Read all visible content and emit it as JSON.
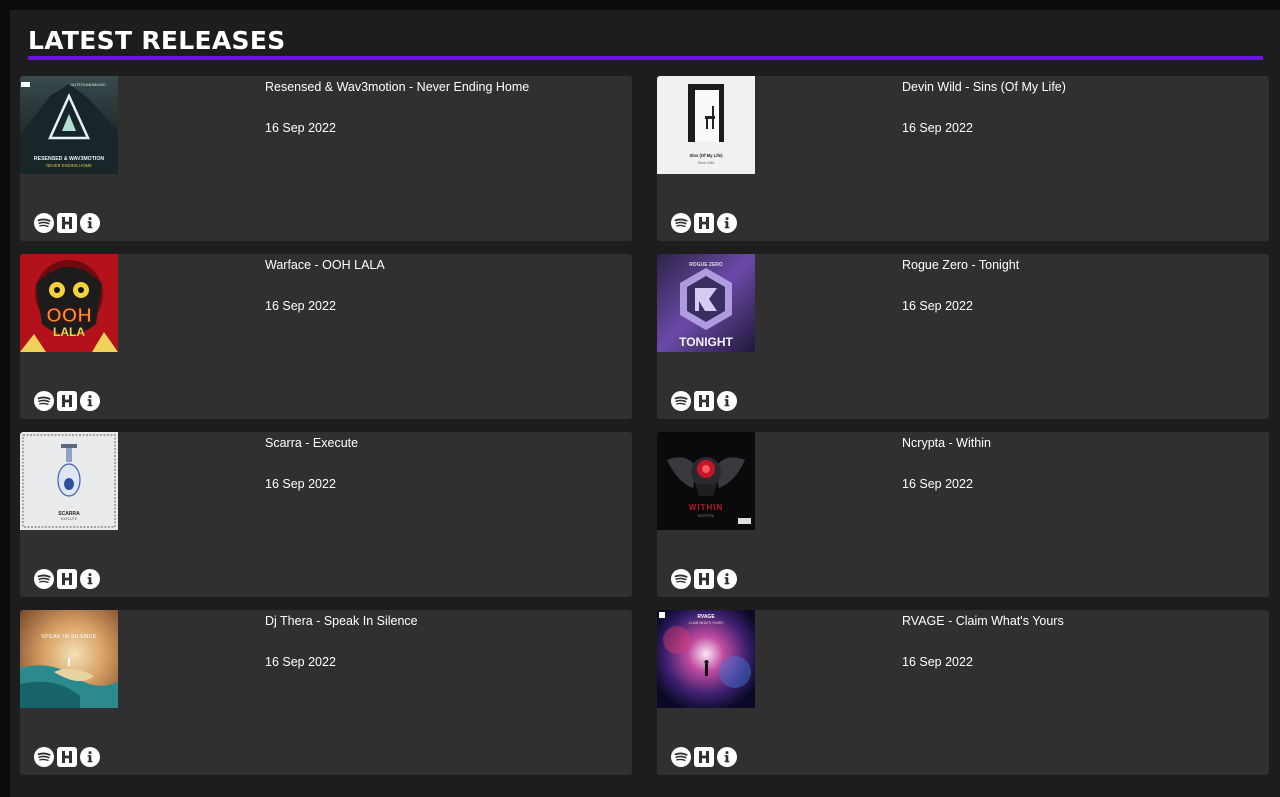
{
  "section": {
    "title": "LATEST RELEASES"
  },
  "releases": [
    {
      "title": "Resensed & Wav3motion - Never Ending Home",
      "date": "16 Sep 2022",
      "cover": "dark-mountain-triangle-art",
      "cover_text": {
        "top": "OUTFOUNDMUSIC",
        "main": "RESENSED & WAV3MOTION",
        "sub": "NEVER ENDING HOME"
      }
    },
    {
      "title": "Devin Wild - Sins (Of My Life)",
      "date": "16 Sep 2022",
      "cover": "white-doorway-chair-art",
      "cover_text": {
        "main": "Sins (Of My Life)",
        "sub": "Devin Wild"
      }
    },
    {
      "title": "Warface - OOH LALA",
      "date": "16 Sep 2022",
      "cover": "red-comic-face-art",
      "cover_text": {
        "main": "OOH",
        "sub": "LALA"
      }
    },
    {
      "title": "Rogue Zero - Tonight",
      "date": "16 Sep 2022",
      "cover": "purple-hexagon-logo-art",
      "cover_text": {
        "top": "ROGUE ZERO",
        "main": "TONIGHT"
      }
    },
    {
      "title": "Scarra - Execute",
      "date": "16 Sep 2022",
      "cover": "white-hand-grenade-art",
      "cover_text": {
        "main": "SCARRA",
        "sub": "EXECUTE"
      }
    },
    {
      "title": "Ncrypta - Within",
      "date": "16 Sep 2022",
      "cover": "dark-red-skull-art",
      "cover_text": {
        "main": "WITHIN",
        "sub": "NCRYPTA"
      }
    },
    {
      "title": "Dj Thera - Speak In Silence",
      "date": "16 Sep 2022",
      "cover": "teal-island-figure-art",
      "cover_text": {
        "main": "SPEAK IN SILENCE"
      }
    },
    {
      "title": "RVAGE - Claim What's Yours",
      "date": "16 Sep 2022",
      "cover": "cosmic-nebula-figure-art",
      "cover_text": {
        "top": "RVAGE",
        "main": "CLAIM WHAT'S YOURS"
      }
    }
  ],
  "actions": [
    {
      "name": "spotify-icon",
      "label": "Spotify"
    },
    {
      "name": "hardstyle-h-icon",
      "label": "Hardstyle"
    },
    {
      "name": "info-icon",
      "label": "Info"
    }
  ],
  "colors": {
    "accent": "#6a16d6",
    "card": "#303030",
    "panel": "#1d1d1d",
    "page": "#0b0b0b"
  }
}
